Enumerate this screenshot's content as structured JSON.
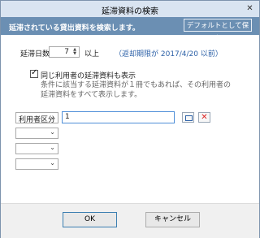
{
  "window": {
    "title": "延滞資料の検索",
    "close_glyph": "✕"
  },
  "header": {
    "text": "延滞されている貸出資料を検索します。",
    "default_save_label": "デフォルトとして保存"
  },
  "overdue_days": {
    "label": "延滞日数",
    "value": "7",
    "suffix": "以上",
    "return_date_note": "（返却期限が 2017/4/20 以前）"
  },
  "same_user_option": {
    "checked": true,
    "label": "同じ利用者の延滞資料も表示",
    "description_line1": "条件に該当する延滞資料が１冊でもあれば、その利用者の",
    "description_line2": "延滞資料をすべて表示します。"
  },
  "conditions": {
    "rows": [
      {
        "field": "利用者区分",
        "value": "1"
      },
      {
        "field": ""
      },
      {
        "field": ""
      },
      {
        "field": ""
      }
    ]
  },
  "footer": {
    "ok_label": "OK",
    "cancel_label": "キャンセル"
  },
  "colors": {
    "header_bg": "#6b8fb3",
    "note_blue": "#2e62a8",
    "clear_red": "#dd2222"
  }
}
